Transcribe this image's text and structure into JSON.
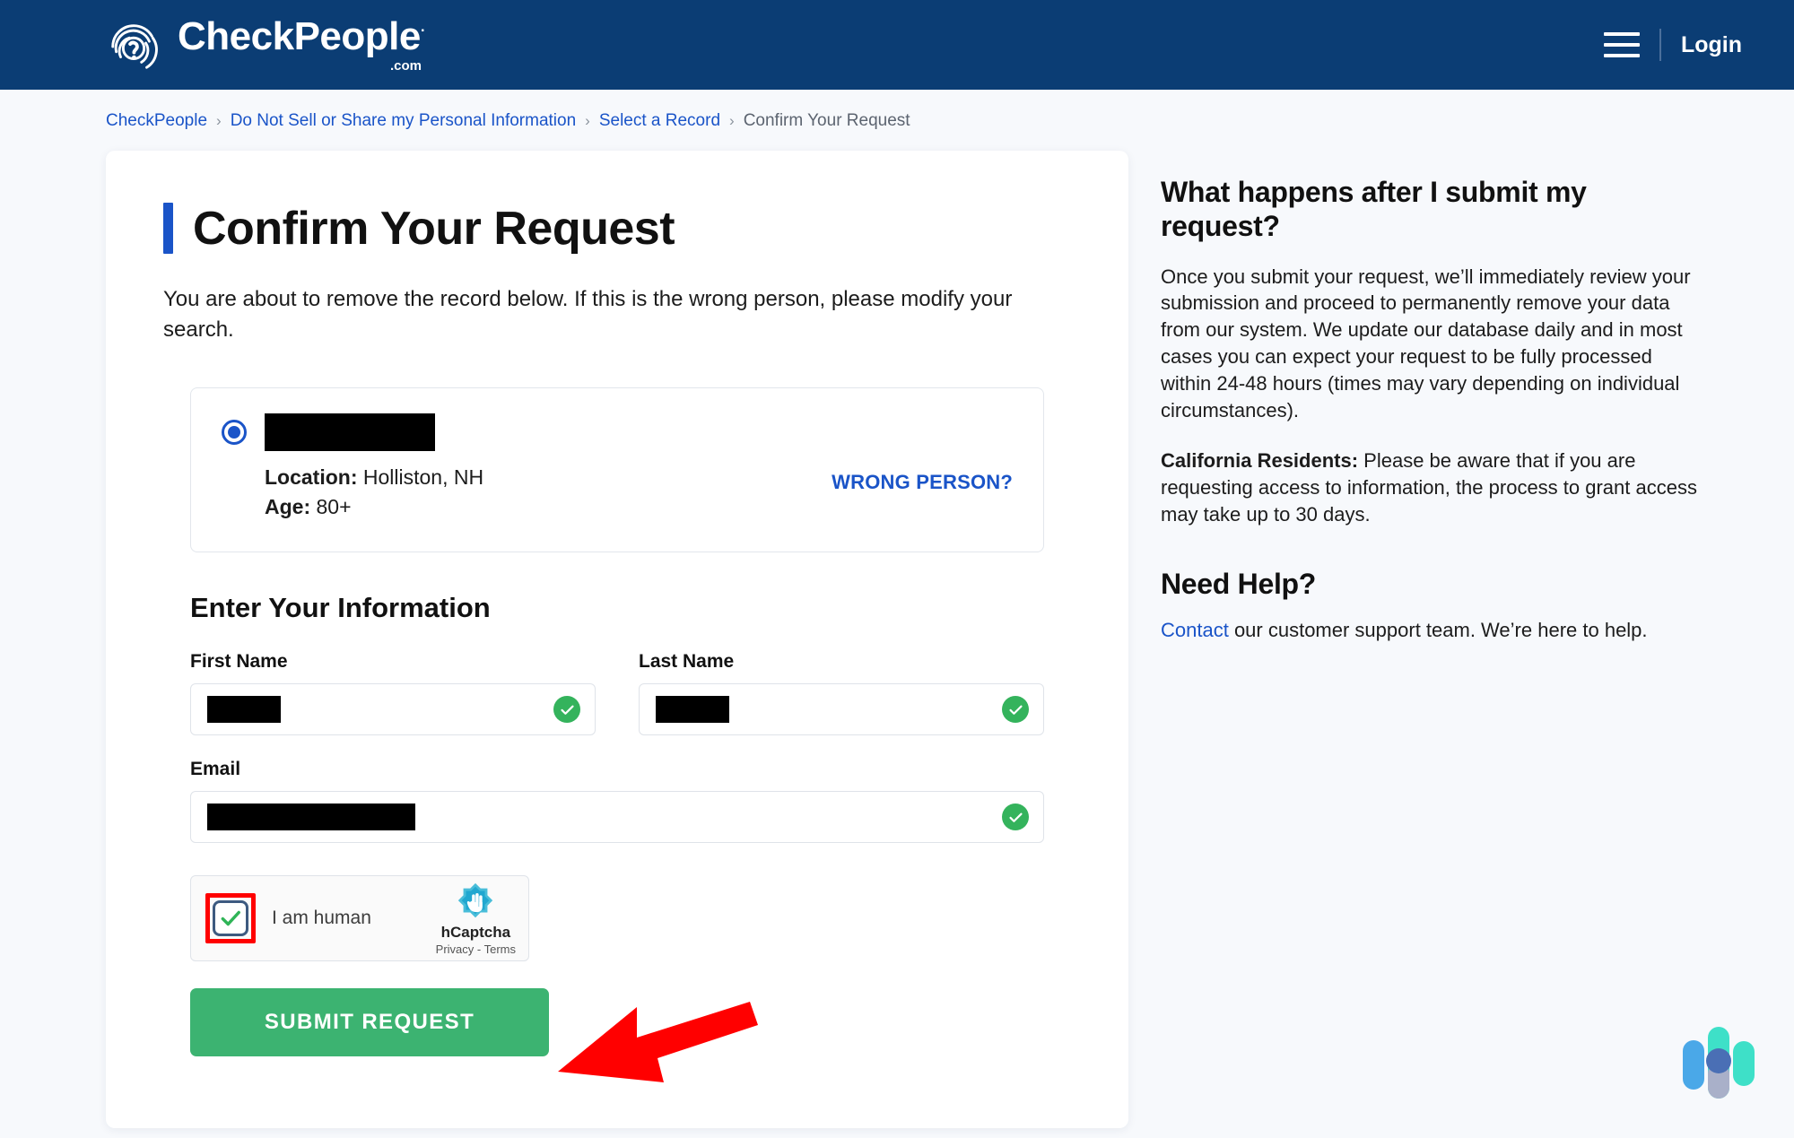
{
  "header": {
    "brand_name": "CheckPeople",
    "brand_reg": "·",
    "brand_dotcom": ".com",
    "logo_icon": "fingerprint-question-icon",
    "menu_icon": "hamburger-menu-icon",
    "login_label": "Login",
    "background_color": "#0b3d74"
  },
  "breadcrumb": {
    "items": [
      {
        "label": "CheckPeople",
        "is_link": true
      },
      {
        "label": "Do Not Sell or Share my Personal Information",
        "is_link": true
      },
      {
        "label": "Select a Record",
        "is_link": true
      },
      {
        "label": "Confirm Your Request",
        "is_link": false
      }
    ],
    "separator": "›"
  },
  "main": {
    "title": "Confirm Your Request",
    "accent_color": "#1a54c8",
    "lede": "You are about to remove the record below. If this is the wrong person, please modify your search.",
    "record": {
      "selected": true,
      "name_redacted": true,
      "location_label": "Location:",
      "location_value": "Holliston, NH",
      "age_label": "Age:",
      "age_value": "80+",
      "wrong_person_label": "WRONG PERSON?"
    },
    "form": {
      "section_title": "Enter Your Information",
      "fields": [
        {
          "label": "First Name",
          "value_redacted": true,
          "valid": true,
          "placeholder": "First Name"
        },
        {
          "label": "Last Name",
          "value_redacted": true,
          "valid": true,
          "placeholder": "Last Name"
        },
        {
          "label": "Email",
          "value_redacted": true,
          "valid": true,
          "placeholder": "Email"
        }
      ],
      "valid_icon": "check-circle-icon"
    },
    "captcha": {
      "checkbox_label": "I am human",
      "checked": true,
      "highlight_color": "#ff0000",
      "provider_name": "hCaptcha",
      "provider_links": "Privacy - Terms",
      "logo_icon": "hcaptcha-hand-icon"
    },
    "submit_label": "SUBMIT REQUEST",
    "submit_color": "#3cb371"
  },
  "annotation": {
    "arrow_color": "#ff0000",
    "arrow_target": "submit-request-button",
    "arrow_icon": "arrow-pointing-left-icon"
  },
  "sidebar": {
    "heading_1": "What happens after I submit my request?",
    "paragraph_1": "Once you submit your request, we’ll immediately review your submission and proceed to permanently remove your data from our system. We update our database daily and in most cases you can expect your request to be fully processed within 24-48 hours (times may vary depending on individual circumstances).",
    "california_label": "California Residents:",
    "california_text": " Please be aware that if you are requesting access to information, the process to grant access may take up to 30 days.",
    "heading_2": "Need Help?",
    "help_link": "Contact",
    "help_text": " our customer support team. We’re here to help."
  },
  "widget": {
    "name": "chat-assistant-widget",
    "bar_colors": [
      "#4aa8e8",
      "#3ee0c8",
      "#3ee0c8"
    ],
    "dot_color": "#4a6fb5"
  }
}
